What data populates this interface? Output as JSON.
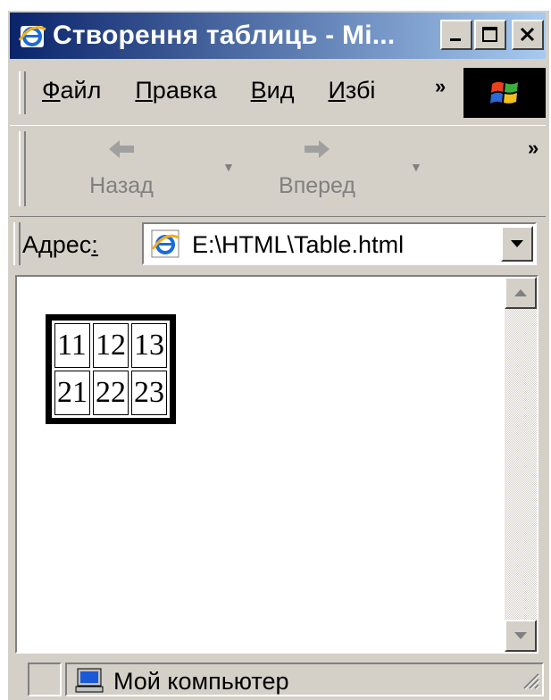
{
  "window": {
    "title": "Створення таблиць - Mi..."
  },
  "menu": {
    "items": [
      {
        "label_acc": "Ф",
        "label_rest": "айл"
      },
      {
        "label_acc": "П",
        "label_rest": "равка"
      },
      {
        "label_acc": "В",
        "label_rest": "ид"
      },
      {
        "label_acc": "И",
        "label_rest": "збі"
      }
    ],
    "overflow": "»"
  },
  "toolbar": {
    "back_label": "Назад",
    "forward_label": "Вперед",
    "overflow": "»"
  },
  "address": {
    "label": "Адрес",
    "label_acc": ":",
    "value": "E:\\HTML\\Table.html"
  },
  "table": {
    "rows": [
      [
        "11",
        "12",
        "13"
      ],
      [
        "21",
        "22",
        "23"
      ]
    ]
  },
  "status": {
    "zone": "Мой компьютер"
  },
  "colors": {
    "titlebar_start": "#0a246a",
    "titlebar_end": "#a6caf0",
    "chrome": "#d4d0c8"
  }
}
